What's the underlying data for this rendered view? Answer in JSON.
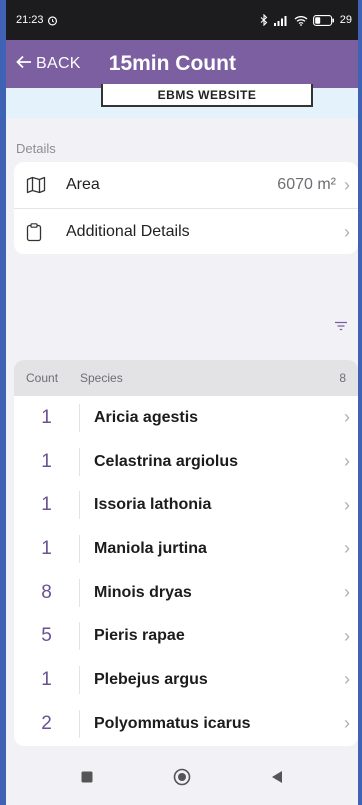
{
  "status": {
    "time": "21:23",
    "battery": "29"
  },
  "appbar": {
    "back_label": "BACK",
    "title": "15min Count"
  },
  "website_button": "EBMS WEBSITE",
  "details": {
    "label": "Details",
    "area_label": "Area",
    "area_value": "6070 m²",
    "additional_label": "Additional Details"
  },
  "species_list": {
    "count_header": "Count",
    "species_header": "Species",
    "total": "8",
    "rows": [
      {
        "count": "1",
        "name": "Aricia agestis"
      },
      {
        "count": "1",
        "name": "Celastrina argiolus"
      },
      {
        "count": "1",
        "name": "Issoria lathonia"
      },
      {
        "count": "1",
        "name": "Maniola jurtina"
      },
      {
        "count": "8",
        "name": "Minois dryas"
      },
      {
        "count": "5",
        "name": "Pieris rapae"
      },
      {
        "count": "1",
        "name": "Plebejus argus"
      },
      {
        "count": "2",
        "name": "Polyommatus icarus"
      }
    ]
  },
  "colors": {
    "appbar": "#7b5fa0",
    "accent": "#6a5194"
  }
}
